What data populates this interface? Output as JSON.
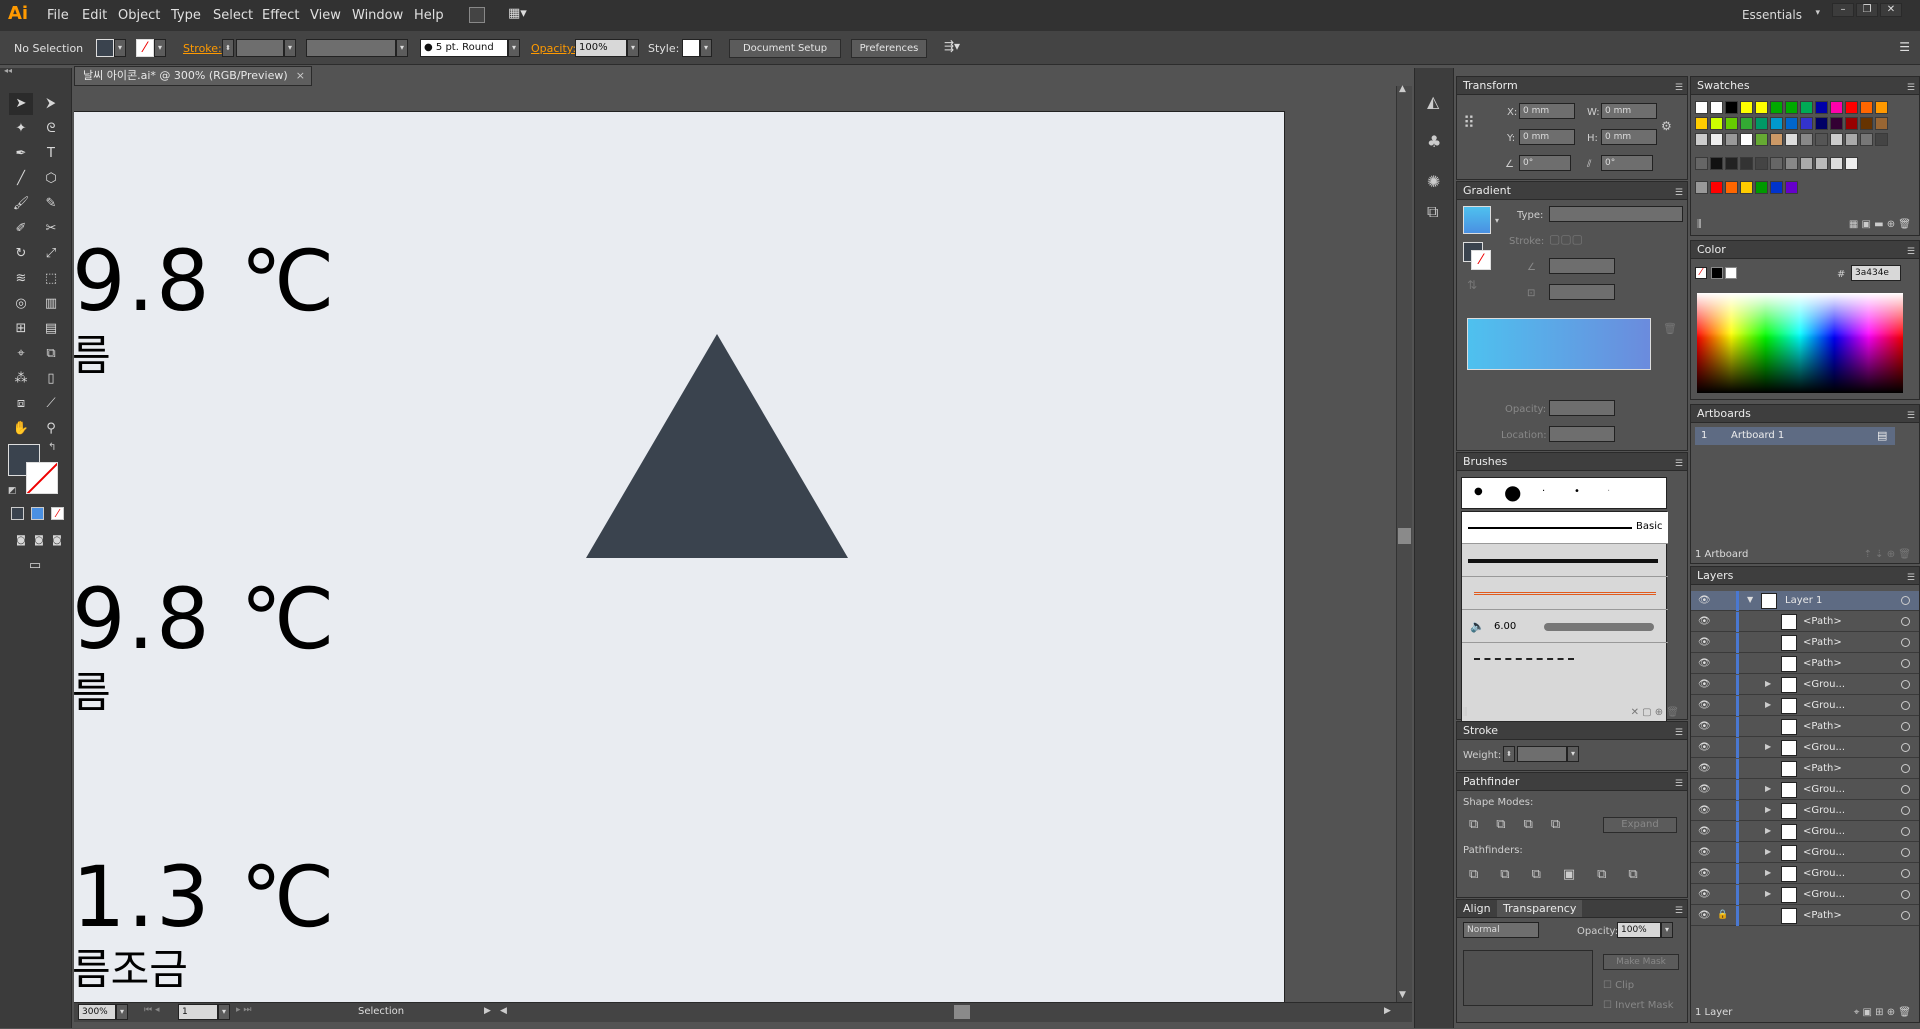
{
  "app": {
    "logo": "Ai",
    "menus": [
      "File",
      "Edit",
      "Object",
      "Type",
      "Select",
      "Effect",
      "View",
      "Window",
      "Help"
    ],
    "workspace": "Essentials",
    "window_buttons": [
      "–",
      "❐",
      "✕"
    ]
  },
  "control_bar": {
    "selection": "No Selection",
    "stroke_label": "Stroke:",
    "brush": "5 pt. Round",
    "opacity_label": "Opacity:",
    "opacity_value": "100%",
    "style_label": "Style:",
    "document_setup": "Document Setup",
    "preferences": "Preferences"
  },
  "document": {
    "tab_title": "날씨 아이콘.ai* @ 300% (RGB/Preview)",
    "triangle_color": "#3a434e",
    "artboard_color": "#e9ecf1",
    "temps": [
      {
        "value": "9.8 ℃",
        "desc": "름"
      },
      {
        "value": "9.8 ℃",
        "desc": "름"
      },
      {
        "value": "1.3 ℃",
        "desc": "름조금"
      }
    ]
  },
  "status_bar": {
    "zoom": "300%",
    "page": "1",
    "mode": "Selection"
  },
  "panels": {
    "transform": {
      "title": "Transform",
      "x_label": "X:",
      "x_value": "0 mm",
      "y_label": "Y:",
      "y_value": "0 mm",
      "w_label": "W:",
      "w_value": "0 mm",
      "h_label": "H:",
      "h_value": "0 mm",
      "angle_value": "0°",
      "shear_value": "0°"
    },
    "gradient": {
      "title": "Gradient",
      "type_label": "Type:",
      "stroke_label": "Stroke:",
      "opacity_label": "Opacity:",
      "location_label": "Location:",
      "start_color": "#4ec1ef",
      "end_color": "#6b8bdd"
    },
    "brushes": {
      "title": "Brushes",
      "basic_label": "Basic",
      "size_value": "6.00"
    },
    "stroke": {
      "title": "Stroke",
      "weight_label": "Weight:"
    },
    "pathfinder": {
      "title": "Pathfinder",
      "shape_modes": "Shape Modes:",
      "pathfinders": "Pathfinders:",
      "expand": "Expand"
    },
    "align_tab": "Align",
    "transparency": {
      "title": "Transparency",
      "blend": "Normal",
      "opacity_label": "Opacity:",
      "opacity_value": "100%",
      "make_mask": "Make Mask",
      "clip": "Clip",
      "invert_mask": "Invert Mask"
    },
    "swatches": {
      "title": "Swatches"
    },
    "color": {
      "title": "Color",
      "hex_label": "#",
      "hex_value": "3a434e"
    },
    "artboards": {
      "title": "Artboards",
      "rows": [
        {
          "num": "1",
          "name": "Artboard 1"
        }
      ],
      "footer": "1 Artboard"
    },
    "layers": {
      "title": "Layers",
      "layer_name": "Layer 1",
      "items": [
        "<Path>",
        "<Path>",
        "<Path>",
        "<Grou...",
        "<Grou...",
        "<Path>",
        "<Grou...",
        "<Path>",
        "<Grou...",
        "<Grou...",
        "<Grou...",
        "<Grou...",
        "<Grou...",
        "<Grou...",
        "<Path>"
      ],
      "footer": "1 Layer"
    }
  }
}
